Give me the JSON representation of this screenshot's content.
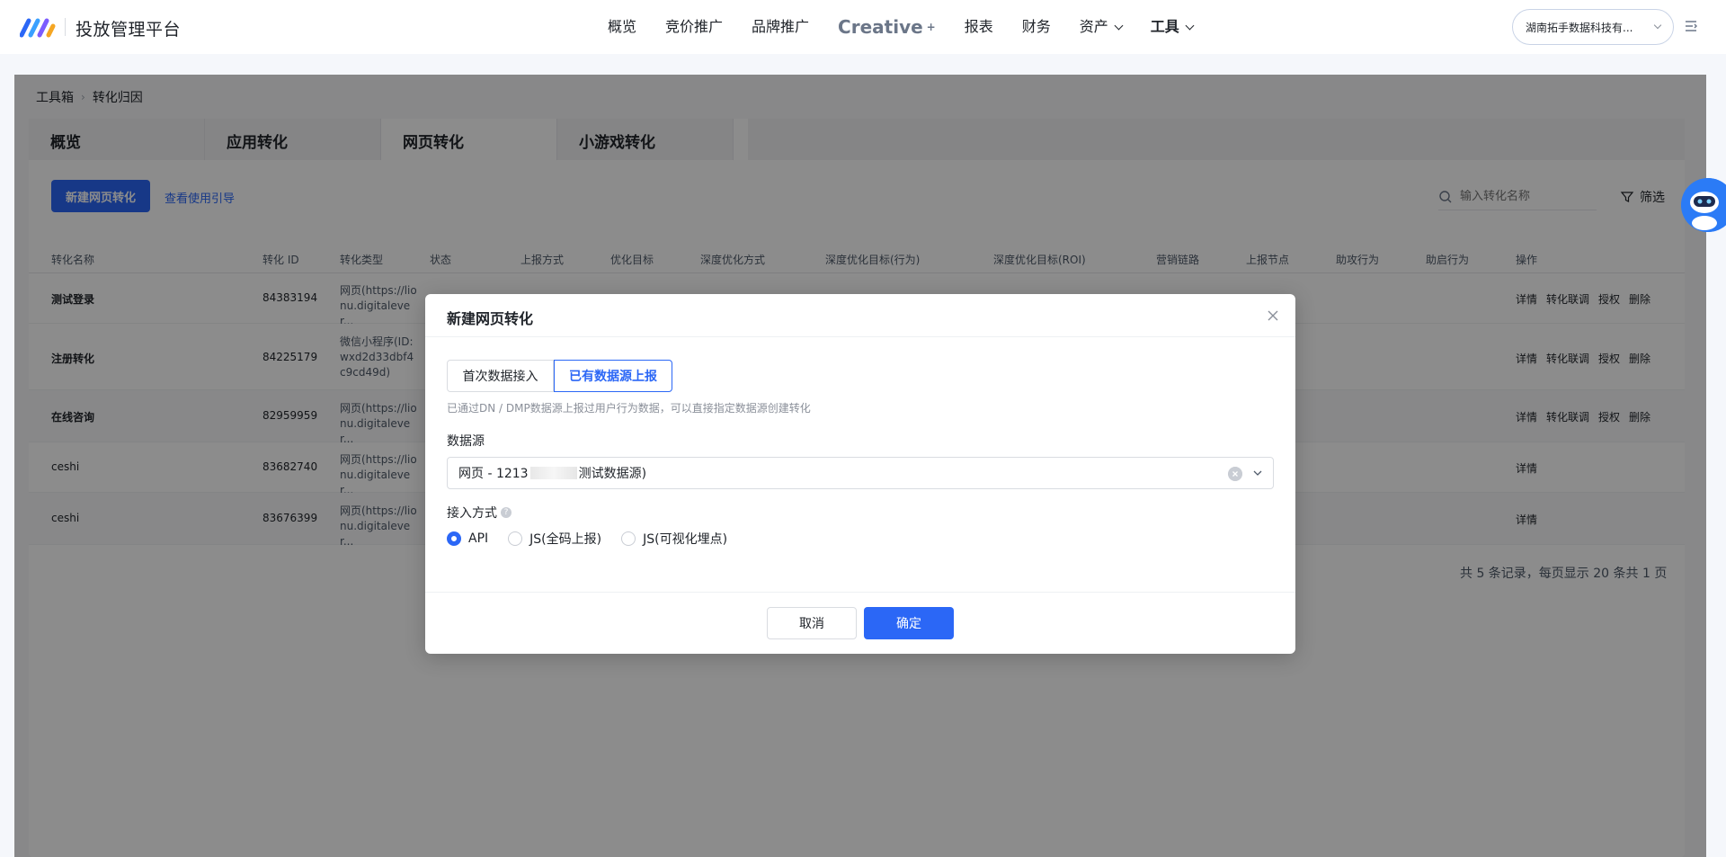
{
  "header": {
    "brand": "投放管理平台",
    "nav": [
      {
        "label": "概览"
      },
      {
        "label": "竞价推广"
      },
      {
        "label": "品牌推广"
      },
      {
        "label": "Creative",
        "suffix": "+"
      },
      {
        "label": "报表"
      },
      {
        "label": "财务"
      },
      {
        "label": "资产"
      },
      {
        "label": "工具"
      }
    ],
    "account": "湖南拓手数据科技有..."
  },
  "breadcrumb": [
    "工具箱",
    "转化归因"
  ],
  "tabs": [
    "概览",
    "应用转化",
    "网页转化",
    "小游戏转化"
  ],
  "toolbar": {
    "new_button": "新建网页转化",
    "guide_link": "查看使用引导",
    "search_placeholder": "输入转化名称",
    "filter": "筛选"
  },
  "table": {
    "headers": [
      "转化名称",
      "转化 ID",
      "转化类型",
      "状态",
      "上报方式",
      "优化目标",
      "深度优化方式",
      "深度优化目标(行为)",
      "深度优化目标(ROI)",
      "营销链路",
      "上报节点",
      "助攻行为",
      "助启行为",
      "操作"
    ],
    "rows": [
      {
        "name": "测试登录",
        "id": "84383194",
        "type": "网页(https://lionu.digitalever...",
        "ops": [
          "详情",
          "转化联调",
          "授权",
          "删除"
        ]
      },
      {
        "name": "注册转化",
        "id": "84225179",
        "type": "微信小程序(ID: wxd2d33dbf4c9cd49d)",
        "ops": [
          "详情",
          "转化联调",
          "授权",
          "删除"
        ]
      },
      {
        "name": "在线咨询",
        "id": "82959959",
        "type": "网页(https://lionu.digitalever...",
        "ops": [
          "详情",
          "转化联调",
          "授权",
          "删除"
        ]
      },
      {
        "name": "ceshi",
        "id": "83682740",
        "type": "网页(https://lionu.digitalever...",
        "ops": [
          "详情"
        ]
      },
      {
        "name": "ceshi",
        "id": "83676399",
        "type": "网页(https://lionu.digitalever...",
        "ops": [
          "详情"
        ]
      }
    ],
    "pager": "共 5 条记录，每页显示 20 条共 1 页"
  },
  "modal": {
    "title": "新建网页转化",
    "seg_first": "首次数据接入",
    "seg_second": "已有数据源上报",
    "hint": "已通过DN / DMP数据源上报过用户行为数据，可以直接指定数据源创建转化",
    "datasource_label": "数据源",
    "datasource_prefix": "网页 - 1213",
    "datasource_suffix": "测试数据源)",
    "access_label": "接入方式",
    "options": [
      "API",
      "JS(全码上报)",
      "JS(可视化埋点)"
    ],
    "selected_option": "API",
    "cancel": "取消",
    "confirm": "确定"
  },
  "colors": {
    "primary": "#2b67f6",
    "mask": "rgba(0,0,0,0.45)"
  }
}
